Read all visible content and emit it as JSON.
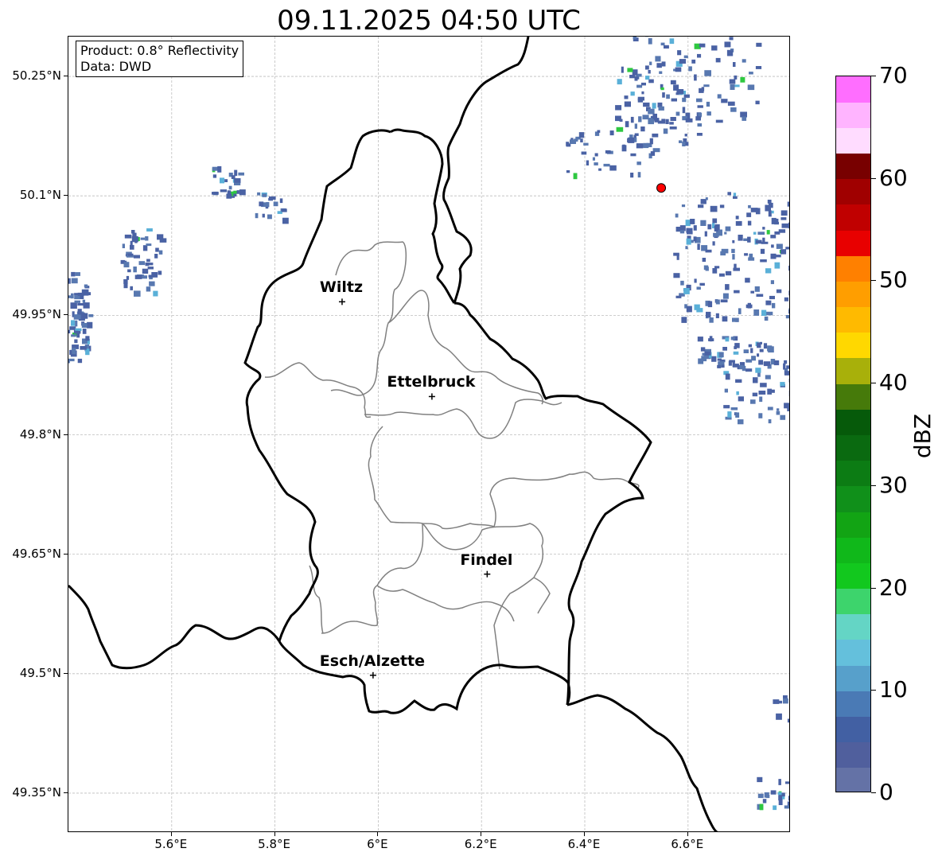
{
  "title": "09.11.2025 04:50 UTC",
  "info": {
    "product": "Product: 0.8° Reflectivity",
    "data": "Data: DWD"
  },
  "map": {
    "lon_range": [
      5.4,
      6.8
    ],
    "lat_range": [
      49.3,
      50.3
    ],
    "lat_ticks": [
      {
        "value": 50.25,
        "label": "50.25°N"
      },
      {
        "value": 50.1,
        "label": "50.1°N"
      },
      {
        "value": 49.95,
        "label": "49.95°N"
      },
      {
        "value": 49.8,
        "label": "49.8°N"
      },
      {
        "value": 49.65,
        "label": "49.65°N"
      },
      {
        "value": 49.5,
        "label": "49.5°N"
      },
      {
        "value": 49.35,
        "label": "49.35°N"
      }
    ],
    "lon_ticks": [
      {
        "value": 5.6,
        "label": "5.6°E"
      },
      {
        "value": 5.8,
        "label": "5.8°E"
      },
      {
        "value": 6.0,
        "label": "6°E"
      },
      {
        "value": 6.2,
        "label": "6.2°E"
      },
      {
        "value": 6.4,
        "label": "6.4°E"
      },
      {
        "value": 6.6,
        "label": "6.6°E"
      }
    ],
    "cities": [
      {
        "name": "Wiltz",
        "lon": 5.93,
        "lat": 49.967
      },
      {
        "name": "Ettelbruck",
        "lon": 6.104,
        "lat": 49.848
      },
      {
        "name": "Findel",
        "lon": 6.211,
        "lat": 49.625
      },
      {
        "name": "Esch/Alzette",
        "lon": 5.99,
        "lat": 49.498
      }
    ],
    "radar_site": {
      "name": "radar-site",
      "lon": 6.548,
      "lat": 50.11,
      "color": "#ff0000"
    }
  },
  "colorbar": {
    "label": "dBZ",
    "min": 0,
    "max": 70,
    "step": 2.5,
    "ticks": [
      {
        "value": 0,
        "label": "0"
      },
      {
        "value": 10,
        "label": "10"
      },
      {
        "value": 20,
        "label": "20"
      },
      {
        "value": 30,
        "label": "30"
      },
      {
        "value": 40,
        "label": "40"
      },
      {
        "value": 50,
        "label": "50"
      },
      {
        "value": 60,
        "label": "60"
      },
      {
        "value": 70,
        "label": "70"
      }
    ],
    "colors": [
      "#6472a6",
      "#505f9d",
      "#4260a3",
      "#4a7ab5",
      "#57a0cb",
      "#64c0dc",
      "#64d5c5",
      "#3dd46c",
      "#12c81e",
      "#10b81a",
      "#12a414",
      "#10901a",
      "#0c7c14",
      "#0a6a10",
      "#065a0a",
      "#467a0a",
      "#a8b00a",
      "#ffd800",
      "#ffba00",
      "#ff9e00",
      "#ff8000",
      "#e80000",
      "#c00000",
      "#a00000",
      "#780000",
      "#ffdcff",
      "#ffb4ff",
      "#ff6eff"
    ]
  },
  "styles": {
    "national_border": "#000000",
    "canton_border": "#808080",
    "echo_colors": [
      "#4a62a4",
      "#5878b0",
      "#5ab0d8",
      "#2ec840"
    ]
  }
}
